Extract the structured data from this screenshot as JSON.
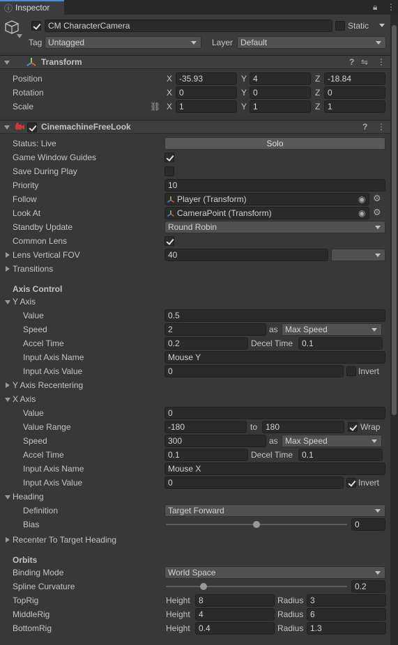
{
  "tab": {
    "title": "Inspector"
  },
  "object": {
    "name": "CM CharacterCamera",
    "static_label": "Static",
    "tag_label": "Tag",
    "tag_value": "Untagged",
    "layer_label": "Layer",
    "layer_value": "Default"
  },
  "transform": {
    "title": "Transform",
    "position_label": "Position",
    "rotation_label": "Rotation",
    "scale_label": "Scale",
    "axis_x": "X",
    "axis_y": "Y",
    "axis_z": "Z",
    "pos_x": "-35.93",
    "pos_y": "4",
    "pos_z": "-18.84",
    "rot_x": "0",
    "rot_y": "0",
    "rot_z": "0",
    "scl_x": "1",
    "scl_y": "1",
    "scl_z": "1"
  },
  "freelook": {
    "title": "CinemachineFreeLook",
    "status_label": "Status: Live",
    "solo_button": "Solo",
    "gwg_label": "Game Window Guides",
    "sdp_label": "Save During Play",
    "priority_label": "Priority",
    "priority_value": "10",
    "follow_label": "Follow",
    "follow_value": "Player (Transform)",
    "lookat_label": "Look At",
    "lookat_value": "CameraPoint (Transform)",
    "standby_label": "Standby Update",
    "standby_value": "Round Robin",
    "lens_label": "Common Lens",
    "fov_label": "Lens Vertical FOV",
    "fov_value": "40",
    "transitions_label": "Transitions",
    "axis_control_label": "Axis Control",
    "yaxis_label": "Y Axis",
    "y_value_label": "Value",
    "y_value": "0.5",
    "y_speed_label": "Speed",
    "y_speed": "2",
    "as_label": "as",
    "y_speed_mode": "Max Speed",
    "y_accel_label": "Accel Time",
    "y_accel": "0.2",
    "decel_label": "Decel Time",
    "y_decel": "0.1",
    "y_input_name_label": "Input Axis Name",
    "y_input_name": "Mouse Y",
    "y_input_value_label": "Input Axis Value",
    "y_input_value": "0",
    "invert_label": "Invert",
    "y_recenter_label": "Y Axis Recentering",
    "xaxis_label": "X Axis",
    "x_value_label": "Value",
    "x_value": "0",
    "x_range_label": "Value Range",
    "x_range_min": "-180",
    "to_label": "to",
    "x_range_max": "180",
    "wrap_label": "Wrap",
    "x_speed_label": "Speed",
    "x_speed": "300",
    "x_speed_mode": "Max Speed",
    "x_accel_label": "Accel Time",
    "x_accel": "0.1",
    "x_decel": "0.1",
    "x_input_name_label": "Input Axis Name",
    "x_input_name": "Mouse X",
    "x_input_value_label": "Input Axis Value",
    "x_input_value": "0",
    "heading_label": "Heading",
    "definition_label": "Definition",
    "definition_value": "Target Forward",
    "bias_label": "Bias",
    "bias_value": "0",
    "recenter_heading_label": "Recenter To Target Heading",
    "orbits_label": "Orbits",
    "binding_label": "Binding Mode",
    "binding_value": "World Space",
    "spline_label": "Spline Curvature",
    "spline_value": "0.2",
    "height_label": "Height",
    "radius_label": "Radius",
    "toprig_label": "TopRig",
    "top_height": "8",
    "top_radius": "3",
    "middlerig_label": "MiddleRig",
    "mid_height": "4",
    "mid_radius": "6",
    "bottomrig_label": "BottomRig",
    "bot_height": "0.4",
    "bot_radius": "1.3"
  },
  "controls": {
    "game_window_guides": true,
    "save_during_play": false,
    "common_lens": true,
    "y_invert": false,
    "x_wrap": true,
    "x_invert": true,
    "static": false,
    "enabled": true,
    "component_enabled": true,
    "bias_slider": 0.5,
    "spline_slider": 0.2
  }
}
